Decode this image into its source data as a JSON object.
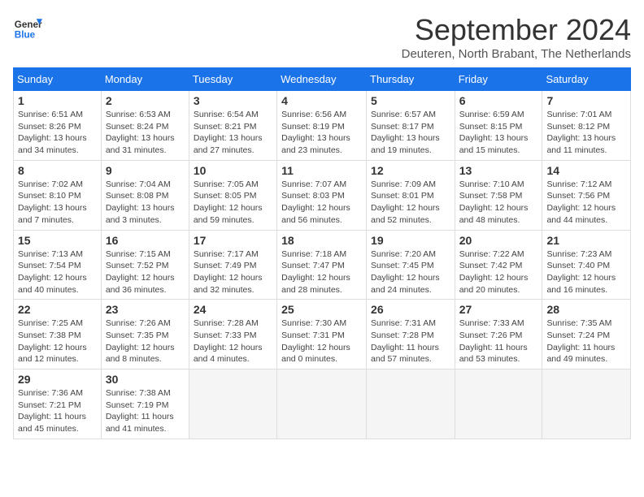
{
  "header": {
    "logo_line1": "General",
    "logo_line2": "Blue",
    "month_title": "September 2024",
    "subtitle": "Deuteren, North Brabant, The Netherlands"
  },
  "weekdays": [
    "Sunday",
    "Monday",
    "Tuesday",
    "Wednesday",
    "Thursday",
    "Friday",
    "Saturday"
  ],
  "days": [
    {
      "num": "",
      "info": ""
    },
    {
      "num": "",
      "info": ""
    },
    {
      "num": "",
      "info": ""
    },
    {
      "num": "",
      "info": ""
    },
    {
      "num": "",
      "info": ""
    },
    {
      "num": "",
      "info": ""
    },
    {
      "num": "1",
      "info": "Sunrise: 6:51 AM\nSunset: 8:26 PM\nDaylight: 13 hours\nand 34 minutes."
    },
    {
      "num": "2",
      "info": "Sunrise: 6:53 AM\nSunset: 8:24 PM\nDaylight: 13 hours\nand 31 minutes."
    },
    {
      "num": "3",
      "info": "Sunrise: 6:54 AM\nSunset: 8:21 PM\nDaylight: 13 hours\nand 27 minutes."
    },
    {
      "num": "4",
      "info": "Sunrise: 6:56 AM\nSunset: 8:19 PM\nDaylight: 13 hours\nand 23 minutes."
    },
    {
      "num": "5",
      "info": "Sunrise: 6:57 AM\nSunset: 8:17 PM\nDaylight: 13 hours\nand 19 minutes."
    },
    {
      "num": "6",
      "info": "Sunrise: 6:59 AM\nSunset: 8:15 PM\nDaylight: 13 hours\nand 15 minutes."
    },
    {
      "num": "7",
      "info": "Sunrise: 7:01 AM\nSunset: 8:12 PM\nDaylight: 13 hours\nand 11 minutes."
    },
    {
      "num": "8",
      "info": "Sunrise: 7:02 AM\nSunset: 8:10 PM\nDaylight: 13 hours\nand 7 minutes."
    },
    {
      "num": "9",
      "info": "Sunrise: 7:04 AM\nSunset: 8:08 PM\nDaylight: 13 hours\nand 3 minutes."
    },
    {
      "num": "10",
      "info": "Sunrise: 7:05 AM\nSunset: 8:05 PM\nDaylight: 12 hours\nand 59 minutes."
    },
    {
      "num": "11",
      "info": "Sunrise: 7:07 AM\nSunset: 8:03 PM\nDaylight: 12 hours\nand 56 minutes."
    },
    {
      "num": "12",
      "info": "Sunrise: 7:09 AM\nSunset: 8:01 PM\nDaylight: 12 hours\nand 52 minutes."
    },
    {
      "num": "13",
      "info": "Sunrise: 7:10 AM\nSunset: 7:58 PM\nDaylight: 12 hours\nand 48 minutes."
    },
    {
      "num": "14",
      "info": "Sunrise: 7:12 AM\nSunset: 7:56 PM\nDaylight: 12 hours\nand 44 minutes."
    },
    {
      "num": "15",
      "info": "Sunrise: 7:13 AM\nSunset: 7:54 PM\nDaylight: 12 hours\nand 40 minutes."
    },
    {
      "num": "16",
      "info": "Sunrise: 7:15 AM\nSunset: 7:52 PM\nDaylight: 12 hours\nand 36 minutes."
    },
    {
      "num": "17",
      "info": "Sunrise: 7:17 AM\nSunset: 7:49 PM\nDaylight: 12 hours\nand 32 minutes."
    },
    {
      "num": "18",
      "info": "Sunrise: 7:18 AM\nSunset: 7:47 PM\nDaylight: 12 hours\nand 28 minutes."
    },
    {
      "num": "19",
      "info": "Sunrise: 7:20 AM\nSunset: 7:45 PM\nDaylight: 12 hours\nand 24 minutes."
    },
    {
      "num": "20",
      "info": "Sunrise: 7:22 AM\nSunset: 7:42 PM\nDaylight: 12 hours\nand 20 minutes."
    },
    {
      "num": "21",
      "info": "Sunrise: 7:23 AM\nSunset: 7:40 PM\nDaylight: 12 hours\nand 16 minutes."
    },
    {
      "num": "22",
      "info": "Sunrise: 7:25 AM\nSunset: 7:38 PM\nDaylight: 12 hours\nand 12 minutes."
    },
    {
      "num": "23",
      "info": "Sunrise: 7:26 AM\nSunset: 7:35 PM\nDaylight: 12 hours\nand 8 minutes."
    },
    {
      "num": "24",
      "info": "Sunrise: 7:28 AM\nSunset: 7:33 PM\nDaylight: 12 hours\nand 4 minutes."
    },
    {
      "num": "25",
      "info": "Sunrise: 7:30 AM\nSunset: 7:31 PM\nDaylight: 12 hours\nand 0 minutes."
    },
    {
      "num": "26",
      "info": "Sunrise: 7:31 AM\nSunset: 7:28 PM\nDaylight: 11 hours\nand 57 minutes."
    },
    {
      "num": "27",
      "info": "Sunrise: 7:33 AM\nSunset: 7:26 PM\nDaylight: 11 hours\nand 53 minutes."
    },
    {
      "num": "28",
      "info": "Sunrise: 7:35 AM\nSunset: 7:24 PM\nDaylight: 11 hours\nand 49 minutes."
    },
    {
      "num": "29",
      "info": "Sunrise: 7:36 AM\nSunset: 7:21 PM\nDaylight: 11 hours\nand 45 minutes."
    },
    {
      "num": "30",
      "info": "Sunrise: 7:38 AM\nSunset: 7:19 PM\nDaylight: 11 hours\nand 41 minutes."
    },
    {
      "num": "",
      "info": ""
    },
    {
      "num": "",
      "info": ""
    },
    {
      "num": "",
      "info": ""
    },
    {
      "num": "",
      "info": ""
    },
    {
      "num": "",
      "info": ""
    }
  ]
}
